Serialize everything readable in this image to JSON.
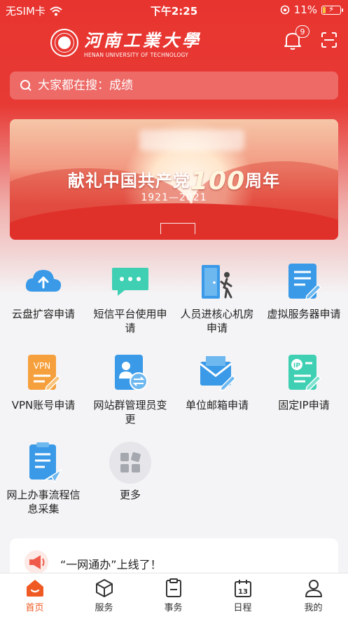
{
  "status_bar": {
    "carrier": "无SIM卡",
    "time": "下午2:25",
    "battery": "11%"
  },
  "header": {
    "logo_cn": "河南工業大學",
    "logo_en": "HENAN UNIVERSITY OF TECHNOLOGY",
    "notification_count": "9"
  },
  "search": {
    "placeholder": "大家都在搜：成绩"
  },
  "banner": {
    "title_prefix": "献礼中国共产党",
    "title_number": "100",
    "title_suffix": "周年",
    "years": "1921—2021"
  },
  "services": [
    {
      "label": "云盘扩容申请",
      "icon": "cloud-upload-icon"
    },
    {
      "label": "短信平台使用申请",
      "icon": "sms-chat-icon"
    },
    {
      "label": "人员进核心机房申请",
      "icon": "door-person-icon"
    },
    {
      "label": "虚拟服务器申请",
      "icon": "server-form-icon"
    },
    {
      "label": "VPN账号申请",
      "icon": "vpn-doc-icon"
    },
    {
      "label": "网站群管理员变更",
      "icon": "admin-swap-icon"
    },
    {
      "label": "单位邮箱申请",
      "icon": "mail-edit-icon"
    },
    {
      "label": "固定IP申请",
      "icon": "ip-doc-icon"
    },
    {
      "label": "网上办事流程信息采集",
      "icon": "form-send-icon"
    },
    {
      "label": "更多",
      "icon": "more-grid-icon"
    }
  ],
  "notice": {
    "text": "“一网通办”上线了！"
  },
  "tabbar": {
    "items": [
      {
        "label": "首页",
        "icon": "home-icon",
        "active": true
      },
      {
        "label": "服务",
        "icon": "cube-icon"
      },
      {
        "label": "事务",
        "icon": "clipboard-icon"
      },
      {
        "label": "日程",
        "icon": "calendar-icon"
      },
      {
        "label": "我的",
        "icon": "profile-icon"
      }
    ],
    "calendar_day": "13"
  },
  "colors": {
    "brand_red": "#e73a35",
    "tab_active": "#ef5a24",
    "icon_blue": "#3a9ae8",
    "icon_teal": "#3fcfb3",
    "icon_orange": "#f5a03c"
  }
}
